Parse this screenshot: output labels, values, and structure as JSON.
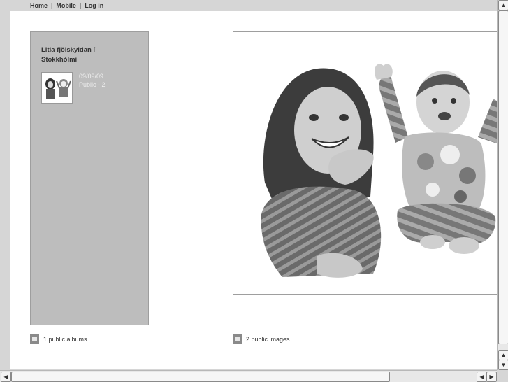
{
  "nav": {
    "home": "Home",
    "mobile": "Mobile",
    "login": "Log in",
    "separator": "|"
  },
  "album": {
    "title": "Litla fjölskyldan í Stokkhólmi",
    "date": "09/09/09",
    "visibility": "Public - 2"
  },
  "footer": {
    "albums": "1 public albums",
    "images": "2 public images"
  },
  "icons": {
    "album": "folder-icon",
    "images": "camera-icon",
    "scroll_up": "arrow-up-icon",
    "scroll_down": "arrow-down-icon",
    "scroll_left": "arrow-left-icon",
    "scroll_right": "arrow-right-icon"
  }
}
